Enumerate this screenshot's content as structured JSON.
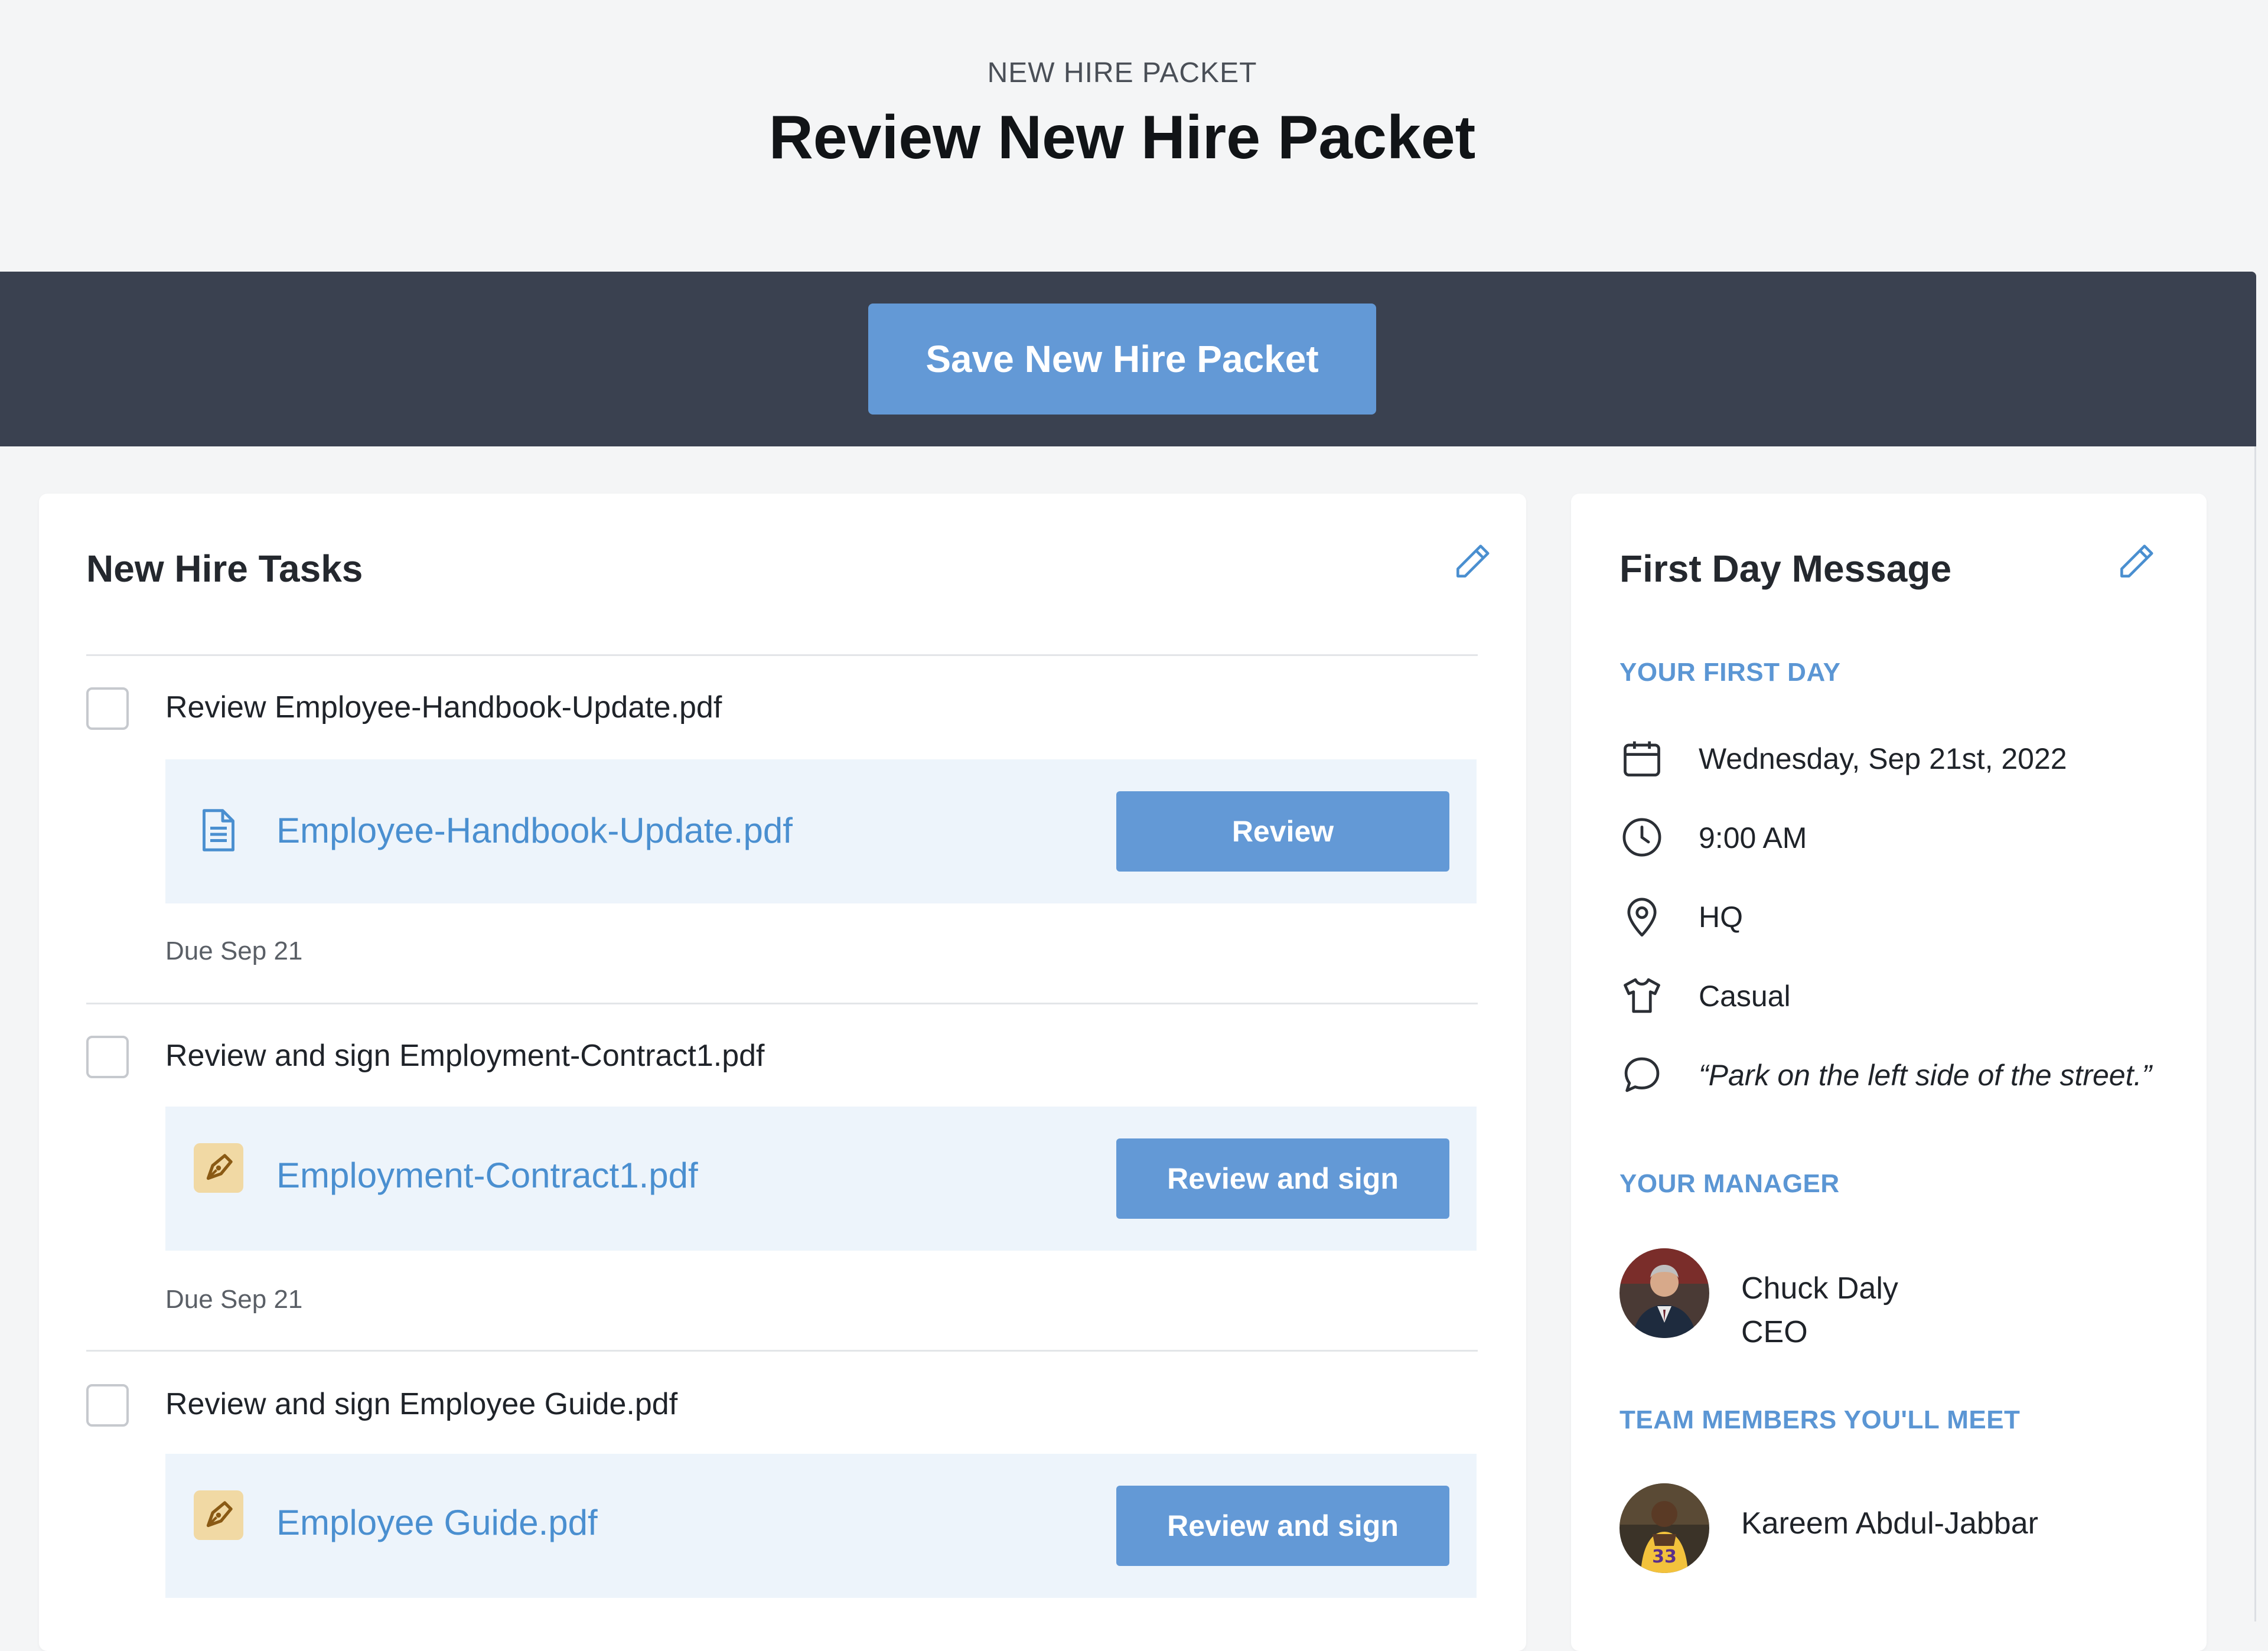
{
  "header": {
    "eyebrow": "NEW HIRE PACKET",
    "title": "Review New Hire Packet"
  },
  "action_bar": {
    "save_label": "Save New Hire Packet",
    "accent_color": "#6399d6",
    "bar_color": "#3a4150"
  },
  "tasks_card": {
    "title": "New Hire Tasks",
    "edit_icon": "pencil-icon",
    "tasks": [
      {
        "title": "Review Employee-Handbook-Update.pdf",
        "file_name": "Employee-Handbook-Update.pdf",
        "file_icon": "document-icon",
        "action_label": "Review",
        "due": "Due Sep 21"
      },
      {
        "title": "Review and sign Employment-Contract1.pdf",
        "file_name": "Employment-Contract1.pdf",
        "file_icon": "signature-pen-icon",
        "action_label": "Review and sign",
        "due": "Due Sep 21"
      },
      {
        "title": "Review and sign Employee Guide.pdf",
        "file_name": "Employee Guide.pdf",
        "file_icon": "signature-pen-icon",
        "action_label": "Review and sign"
      }
    ]
  },
  "first_day_card": {
    "title": "First Day Message",
    "edit_icon": "pencil-icon",
    "first_day_label": "YOUR FIRST DAY",
    "details": [
      {
        "icon": "calendar-icon",
        "text": "Wednesday, Sep 21st, 2022"
      },
      {
        "icon": "clock-icon",
        "text": "9:00 AM"
      },
      {
        "icon": "location-pin-icon",
        "text": "HQ"
      },
      {
        "icon": "shirt-icon",
        "text": "Casual"
      },
      {
        "icon": "speech-bubble-icon",
        "text": "“Park on the left side of the street.”"
      }
    ],
    "manager_label": "YOUR MANAGER",
    "manager": {
      "name": "Chuck Daly",
      "role": "CEO"
    },
    "team_label": "TEAM MEMBERS YOU'LL MEET",
    "team_members": [
      {
        "name": "Kareem Abdul-Jabbar"
      }
    ]
  }
}
